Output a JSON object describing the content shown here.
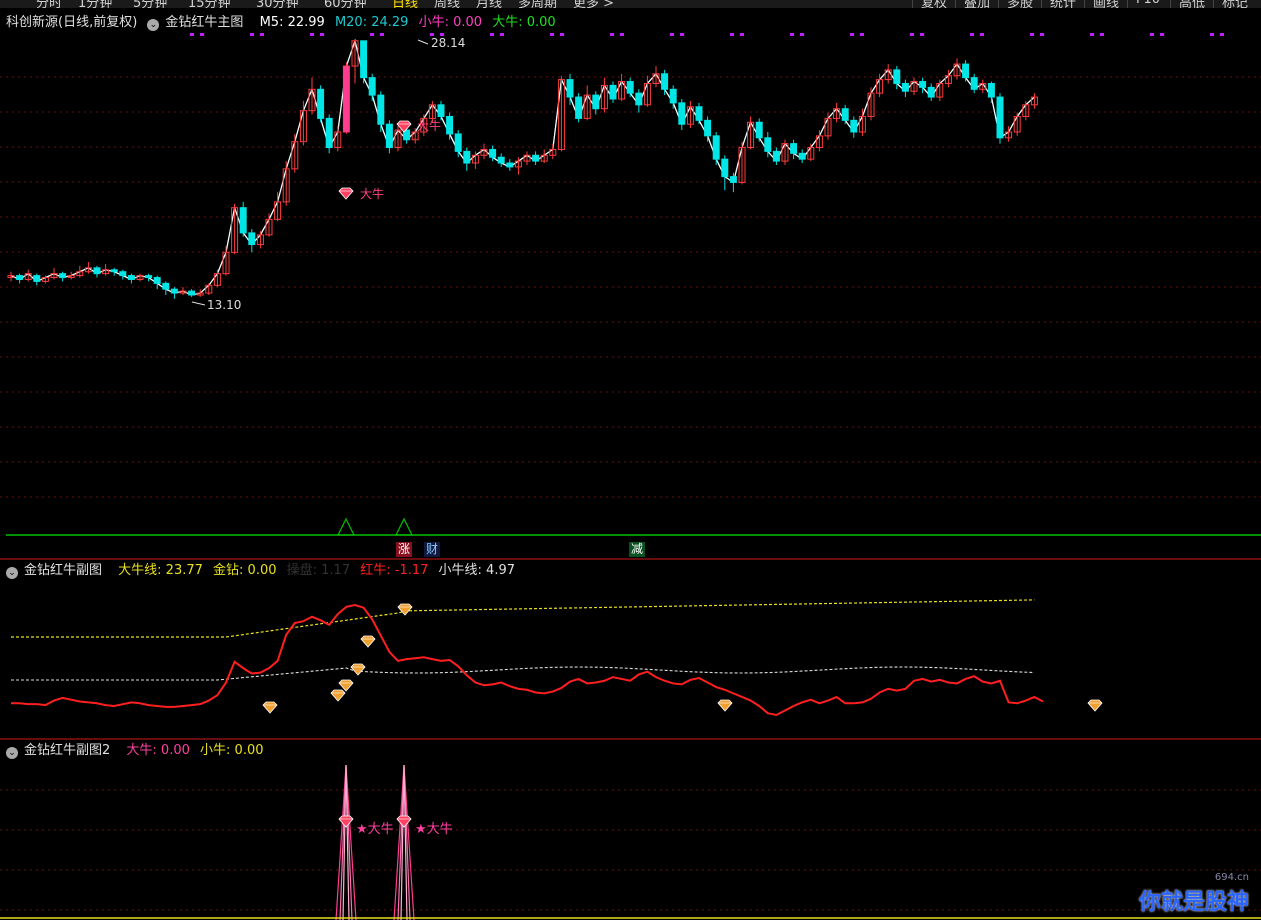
{
  "toolbar": {
    "periods": [
      "分时",
      "1分钟",
      "5分钟",
      "15分钟",
      "30分钟",
      "60分钟",
      "日线",
      "周线",
      "月线",
      "多周期",
      "更多 >"
    ],
    "active_period": "日线",
    "buttons": [
      "复权",
      "叠加",
      "多股",
      "统计",
      "画线",
      "F10",
      "高低",
      "标记"
    ]
  },
  "main": {
    "stock": "科创新源(日线,前复权)",
    "indicator": "金钻红牛主图",
    "m5_label": "M5: 22.99",
    "m20_label": "M20: 24.29",
    "xiaoniu_label": "小牛: 0.00",
    "daniu_label": "大牛: 0.00",
    "high_price": "28.14",
    "low_price": "13.10",
    "signal_text": "大牛",
    "tags": [
      "涨",
      "财",
      "减"
    ]
  },
  "sub1": {
    "indicator": "金钻红牛副图",
    "daniu_line": "大牛线: 23.77",
    "jinzuan": "金钻: 0.00",
    "hidden": "操盘: 1.17",
    "hongniu": "红牛: -1.17",
    "xiaoniu_line": "小牛线: 4.97"
  },
  "sub2": {
    "indicator": "金钻红牛副图2",
    "daniu": "大牛: 0.00",
    "xiaoniu": "小牛: 0.00",
    "signal_text": "★大牛"
  },
  "watermark": {
    "text": "你就是股神",
    "site": "694.cn"
  },
  "colors": {
    "up": "#ff3c3c",
    "down": "#00e5e5",
    "ma5": "#ffffff",
    "ma20": "#20c0c0",
    "hongniu": "#ff1f1f",
    "daniu": "#e8e020",
    "signal": "#ff3ca0"
  },
  "chart_data": {
    "type": "candlestick",
    "price_range": [
      13.1,
      28.14
    ],
    "candles": [
      [
        15.9,
        16.0,
        16.2,
        15.7
      ],
      [
        16.0,
        15.8,
        16.1,
        15.6
      ],
      [
        15.8,
        16.1,
        16.3,
        15.7
      ],
      [
        16.0,
        15.7,
        16.1,
        15.5
      ],
      [
        15.7,
        15.9,
        16.0,
        15.6
      ],
      [
        15.9,
        16.1,
        16.4,
        15.8
      ],
      [
        16.1,
        15.9,
        16.2,
        15.7
      ],
      [
        15.9,
        16.0,
        16.2,
        15.8
      ],
      [
        16.0,
        16.2,
        16.5,
        15.9
      ],
      [
        16.2,
        16.4,
        16.7,
        16.1
      ],
      [
        16.4,
        16.1,
        16.5,
        15.9
      ],
      [
        16.1,
        16.3,
        16.6,
        16.0
      ],
      [
        16.3,
        16.2,
        16.4,
        16.0
      ],
      [
        16.2,
        16.0,
        16.3,
        15.8
      ],
      [
        16.0,
        15.8,
        16.1,
        15.6
      ],
      [
        15.8,
        16.0,
        16.1,
        15.7
      ],
      [
        16.0,
        15.9,
        16.1,
        15.7
      ],
      [
        15.9,
        15.6,
        16.0,
        15.3
      ],
      [
        15.6,
        15.3,
        15.7,
        15.0
      ],
      [
        15.3,
        15.1,
        15.4,
        14.8
      ],
      [
        15.1,
        15.2,
        15.4,
        15.0
      ],
      [
        15.2,
        15.0,
        15.3,
        14.9
      ],
      [
        15.0,
        15.1,
        15.3,
        14.9
      ],
      [
        15.1,
        15.5,
        15.6,
        15.0
      ],
      [
        15.5,
        16.1,
        16.3,
        15.4
      ],
      [
        16.1,
        17.2,
        17.5,
        16.0
      ],
      [
        17.2,
        19.5,
        19.7,
        17.1
      ],
      [
        19.5,
        18.2,
        19.8,
        18.0
      ],
      [
        18.2,
        17.6,
        18.4,
        17.2
      ],
      [
        17.6,
        18.1,
        18.3,
        17.4
      ],
      [
        18.1,
        18.9,
        19.2,
        18.0
      ],
      [
        18.9,
        19.8,
        20.3,
        18.8
      ],
      [
        19.8,
        21.5,
        21.9,
        19.6
      ],
      [
        21.5,
        22.9,
        23.3,
        21.3
      ],
      [
        22.9,
        24.5,
        25.0,
        22.7
      ],
      [
        24.5,
        25.6,
        26.2,
        24.3
      ],
      [
        25.6,
        24.1,
        25.8,
        23.9
      ],
      [
        24.1,
        22.6,
        24.3,
        22.3
      ],
      [
        22.6,
        23.4,
        23.7,
        22.4
      ],
      [
        23.4,
        26.8,
        27.0,
        23.3
      ],
      [
        26.8,
        28.1,
        28.14,
        25.9
      ],
      [
        28.1,
        26.2,
        28.0,
        25.9
      ],
      [
        26.2,
        25.3,
        26.4,
        25.0
      ],
      [
        25.3,
        23.8,
        25.5,
        23.4
      ],
      [
        23.8,
        22.6,
        24.0,
        22.3
      ],
      [
        22.6,
        23.5,
        23.7,
        22.4
      ],
      [
        23.5,
        23.0,
        23.8,
        22.8
      ],
      [
        23.0,
        23.4,
        23.6,
        22.8
      ],
      [
        23.4,
        24.1,
        24.3,
        23.2
      ],
      [
        24.1,
        24.8,
        25.0,
        23.9
      ],
      [
        24.8,
        24.2,
        25.0,
        24.0
      ],
      [
        24.2,
        23.3,
        24.4,
        23.0
      ],
      [
        23.3,
        22.4,
        23.5,
        22.1
      ],
      [
        22.4,
        21.8,
        22.6,
        21.4
      ],
      [
        21.8,
        22.2,
        22.4,
        21.5
      ],
      [
        22.2,
        22.5,
        22.8,
        22.0
      ],
      [
        22.5,
        22.1,
        22.7,
        21.9
      ],
      [
        22.1,
        21.8,
        22.3,
        21.6
      ],
      [
        21.8,
        21.6,
        22.0,
        21.4
      ],
      [
        21.6,
        21.9,
        22.1,
        21.2
      ],
      [
        21.9,
        22.2,
        22.4,
        21.7
      ],
      [
        22.2,
        21.9,
        22.4,
        21.7
      ],
      [
        21.9,
        22.2,
        22.5,
        21.8
      ],
      [
        22.2,
        22.5,
        22.8,
        22.0
      ],
      [
        22.5,
        26.1,
        26.3,
        22.4
      ],
      [
        26.1,
        25.2,
        26.4,
        24.8
      ],
      [
        25.2,
        24.1,
        25.4,
        23.9
      ],
      [
        24.1,
        25.3,
        25.8,
        24.0
      ],
      [
        25.3,
        24.6,
        25.5,
        24.3
      ],
      [
        24.6,
        25.8,
        26.2,
        24.4
      ],
      [
        25.8,
        25.1,
        26.0,
        24.9
      ],
      [
        25.1,
        26.0,
        26.4,
        25.0
      ],
      [
        26.0,
        25.4,
        26.2,
        25.2
      ],
      [
        25.4,
        24.8,
        25.6,
        24.4
      ],
      [
        24.8,
        25.9,
        26.3,
        24.7
      ],
      [
        25.9,
        26.4,
        26.8,
        25.7
      ],
      [
        26.4,
        25.6,
        26.6,
        25.3
      ],
      [
        25.6,
        24.9,
        25.8,
        24.6
      ],
      [
        24.9,
        23.8,
        25.1,
        23.5
      ],
      [
        23.8,
        24.7,
        25.0,
        23.6
      ],
      [
        24.7,
        24.0,
        24.9,
        23.8
      ],
      [
        24.0,
        23.2,
        24.2,
        22.9
      ],
      [
        23.2,
        22.0,
        23.4,
        21.7
      ],
      [
        22.0,
        21.1,
        22.2,
        20.4
      ],
      [
        21.1,
        20.8,
        21.3,
        20.3
      ],
      [
        20.8,
        22.6,
        22.9,
        20.7
      ],
      [
        22.6,
        23.9,
        24.2,
        22.5
      ],
      [
        23.9,
        23.1,
        24.1,
        22.9
      ],
      [
        23.1,
        22.4,
        23.4,
        22.1
      ],
      [
        22.4,
        21.9,
        22.6,
        21.7
      ],
      [
        21.9,
        22.8,
        23.0,
        21.7
      ],
      [
        22.8,
        22.3,
        23.0,
        22.0
      ],
      [
        22.3,
        22.0,
        22.5,
        21.8
      ],
      [
        22.0,
        22.6,
        22.8,
        21.9
      ],
      [
        22.6,
        23.2,
        23.5,
        22.4
      ],
      [
        23.2,
        24.1,
        24.4,
        23.0
      ],
      [
        24.1,
        24.6,
        24.9,
        23.9
      ],
      [
        24.6,
        24.0,
        24.8,
        23.8
      ],
      [
        24.0,
        23.4,
        24.2,
        23.1
      ],
      [
        23.4,
        24.2,
        24.6,
        23.2
      ],
      [
        24.2,
        25.4,
        25.7,
        24.0
      ],
      [
        25.4,
        26.1,
        26.4,
        25.2
      ],
      [
        26.1,
        26.6,
        26.9,
        25.9
      ],
      [
        26.6,
        25.9,
        26.8,
        25.6
      ],
      [
        25.9,
        25.5,
        26.1,
        25.2
      ],
      [
        25.5,
        26.0,
        26.2,
        25.3
      ],
      [
        26.0,
        25.7,
        26.2,
        25.4
      ],
      [
        25.7,
        25.2,
        25.9,
        25.0
      ],
      [
        25.2,
        25.9,
        26.1,
        25.0
      ],
      [
        25.9,
        26.3,
        26.6,
        25.7
      ],
      [
        26.3,
        26.9,
        27.2,
        26.1
      ],
      [
        26.9,
        26.2,
        27.1,
        26.0
      ],
      [
        26.2,
        25.6,
        26.4,
        25.4
      ],
      [
        25.6,
        25.9,
        26.1,
        25.4
      ],
      [
        25.9,
        25.2,
        26.0,
        24.9
      ],
      [
        25.2,
        23.1,
        25.4,
        22.8
      ],
      [
        23.1,
        23.4,
        23.7,
        22.9
      ],
      [
        23.4,
        24.2,
        24.4,
        23.2
      ],
      [
        24.2,
        24.8,
        25.0,
        24.0
      ],
      [
        24.8,
        25.2,
        25.4,
        24.6
      ]
    ],
    "hongniu_series": [
      0.9,
      0.9,
      0.8,
      0.8,
      0.7,
      1.2,
      1.5,
      1.3,
      1.1,
      1.0,
      0.9,
      0.7,
      0.6,
      0.8,
      1.0,
      0.9,
      0.7,
      0.6,
      0.5,
      0.5,
      0.6,
      0.7,
      0.8,
      1.2,
      1.8,
      3.2,
      5.5,
      4.8,
      4.2,
      4.3,
      4.8,
      5.6,
      8.5,
      9.8,
      10.0,
      10.5,
      10.1,
      9.6,
      10.8,
      11.6,
      11.8,
      11.5,
      10.2,
      8.4,
      6.6,
      5.6,
      5.8,
      5.9,
      6.0,
      5.8,
      5.6,
      5.7,
      5.0,
      4.0,
      3.2,
      2.9,
      3.0,
      3.2,
      2.8,
      2.5,
      2.4,
      2.1,
      2.0,
      2.2,
      2.6,
      3.3,
      3.6,
      3.1,
      3.2,
      3.4,
      3.8,
      3.6,
      3.4,
      4.1,
      4.4,
      3.8,
      3.4,
      3.1,
      3.0,
      3.5,
      3.7,
      3.2,
      2.7,
      2.4,
      2.0,
      1.6,
      1.2,
      0.6,
      -0.2,
      -0.4,
      0.1,
      0.6,
      1.0,
      1.3,
      0.9,
      1.2,
      1.6,
      0.9,
      0.9,
      1.0,
      1.4,
      2.1,
      2.5,
      2.3,
      2.5,
      3.4,
      3.6,
      3.3,
      3.5,
      3.2,
      3.1,
      3.6,
      3.9,
      3.3,
      3.1,
      3.4,
      1.0,
      0.9,
      1.2,
      1.6,
      1.1
    ],
    "x_axis_labels": []
  }
}
